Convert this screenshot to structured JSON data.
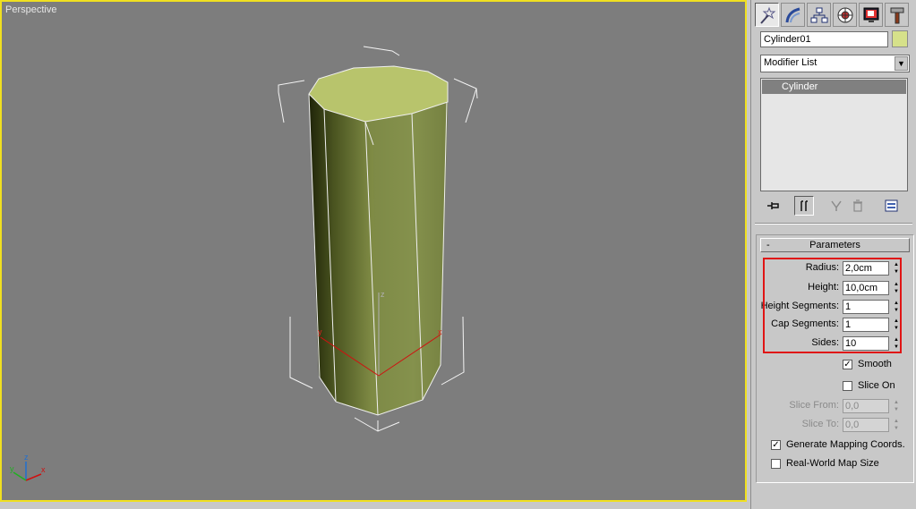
{
  "viewport": {
    "label": "Perspective",
    "axis_labels": {
      "x": "x",
      "y": "y",
      "z": "z"
    },
    "gizmo_labels": {
      "x": "x",
      "y": "y",
      "z": "z"
    }
  },
  "command_panel": {
    "tabs": [
      {
        "name": "create",
        "icon": "wand-star-icon"
      },
      {
        "name": "modify",
        "icon": "modify-bend-icon"
      },
      {
        "name": "hierarchy",
        "icon": "hierarchy-icon"
      },
      {
        "name": "motion",
        "icon": "motion-wheel-icon"
      },
      {
        "name": "display",
        "icon": "display-monitor-icon"
      },
      {
        "name": "utilities",
        "icon": "hammer-icon"
      }
    ],
    "object_name": "Cylinder01",
    "object_color": "#d6e18a",
    "modifier_list_label": "Modifier List",
    "stack_item": "Cylinder"
  },
  "parameters": {
    "header": "Parameters",
    "collapse_symbol": "-",
    "radius": {
      "label": "Radius:",
      "value": "2,0cm"
    },
    "height": {
      "label": "Height:",
      "value": "10,0cm"
    },
    "height_segments": {
      "label": "Height Segments:",
      "value": "1"
    },
    "cap_segments": {
      "label": "Cap Segments:",
      "value": "1"
    },
    "sides": {
      "label": "Sides:",
      "value": "10"
    },
    "smooth": {
      "label": "Smooth",
      "checked": true
    },
    "slice_on": {
      "label": "Slice On",
      "checked": false
    },
    "slice_from": {
      "label": "Slice From:",
      "value": "0,0"
    },
    "slice_to": {
      "label": "Slice To:",
      "value": "0,0"
    },
    "generate_mapping": {
      "label": "Generate Mapping Coords.",
      "checked": true
    },
    "real_world_map": {
      "label": "Real-World Map Size",
      "checked": false
    }
  },
  "colors": {
    "viewport_border": "#f0e020",
    "highlight": "#e01515",
    "selection_axis": "#d01010"
  }
}
